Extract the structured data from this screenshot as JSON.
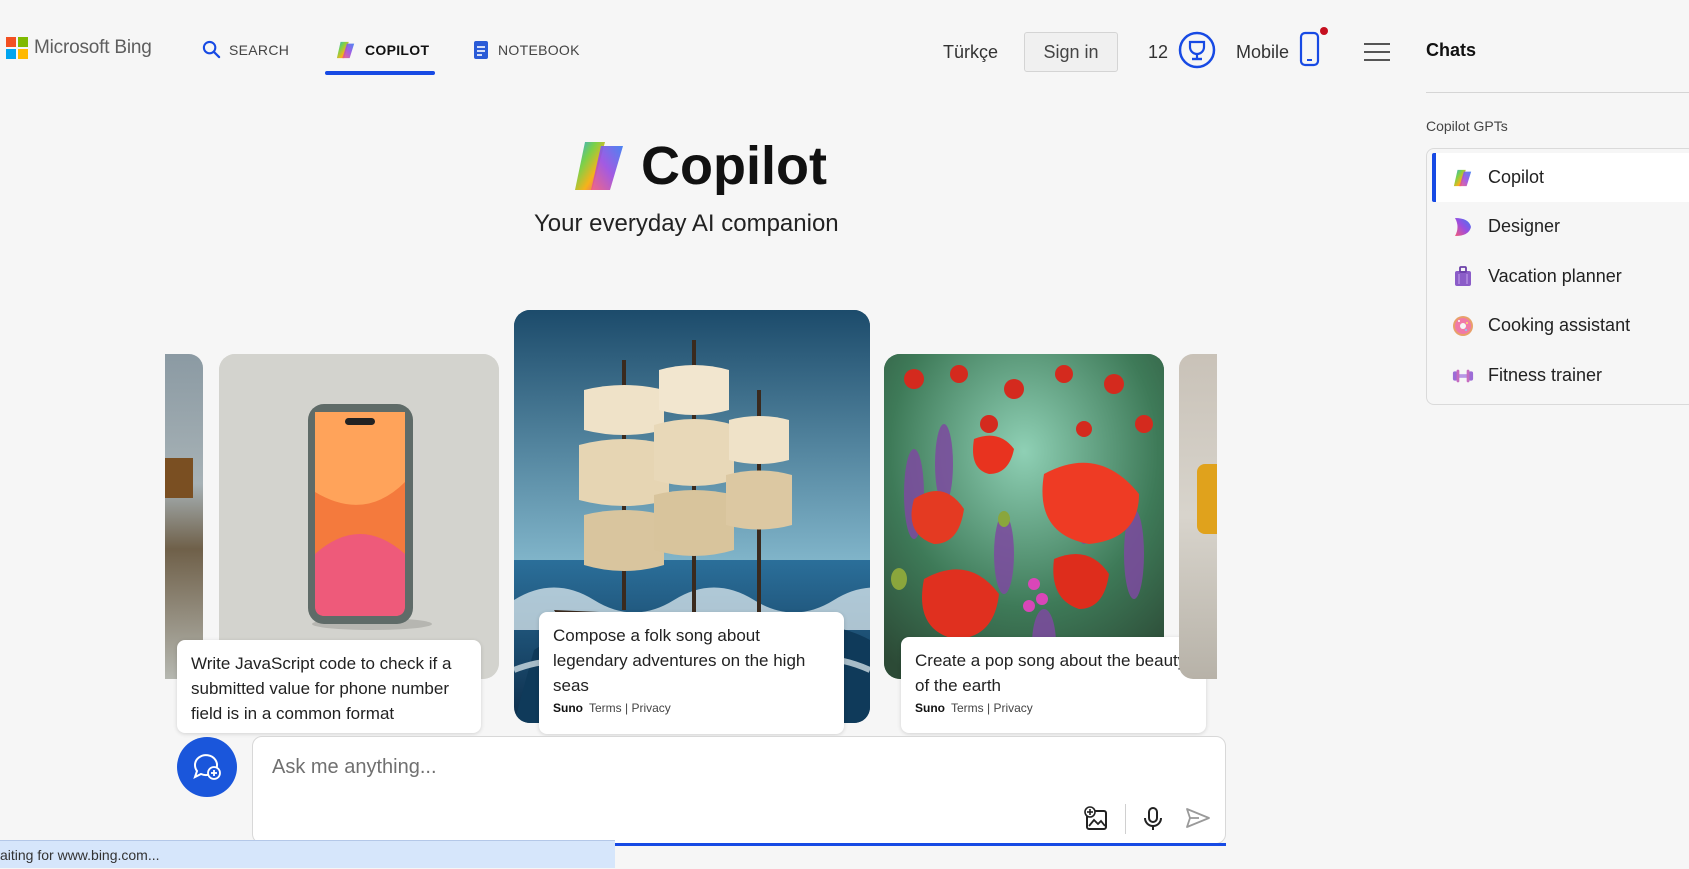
{
  "header": {
    "brand": "Microsoft Bing",
    "nav": [
      {
        "label": "SEARCH",
        "icon": "search-icon"
      },
      {
        "label": "COPILOT",
        "icon": "copilot-icon",
        "active": true
      },
      {
        "label": "NOTEBOOK",
        "icon": "notebook-icon"
      }
    ],
    "language": "Türkçe",
    "sign_in": "Sign in",
    "rewards_count": "12",
    "mobile_label": "Mobile",
    "accent_color": "#174ae4"
  },
  "hero": {
    "title": "Copilot",
    "subtitle": "Your everyday AI companion"
  },
  "carousel": {
    "cards": [
      {
        "id": "phone",
        "caption": "Write JavaScript code to check if a submitted value for phone number field is in a common format"
      },
      {
        "id": "ship",
        "caption": "Compose a folk song about legendary adventures on the high seas",
        "provider": "Suno",
        "links": "Terms | Privacy"
      },
      {
        "id": "poppies",
        "caption": "Create a pop song about the beauty of the earth",
        "provider": "Suno",
        "links": "Terms | Privacy"
      }
    ]
  },
  "composer": {
    "placeholder": "Ask me anything..."
  },
  "status_bar": {
    "text": "aiting for www.bing.com..."
  },
  "sidebar": {
    "title": "Chats",
    "section_label": "Copilot GPTs",
    "items": [
      {
        "label": "Copilot",
        "icon": "copilot-icon",
        "active": true
      },
      {
        "label": "Designer",
        "icon": "designer-icon"
      },
      {
        "label": "Vacation planner",
        "icon": "suitcase-icon"
      },
      {
        "label": "Cooking assistant",
        "icon": "donut-icon"
      },
      {
        "label": "Fitness trainer",
        "icon": "dumbbell-icon"
      }
    ]
  }
}
